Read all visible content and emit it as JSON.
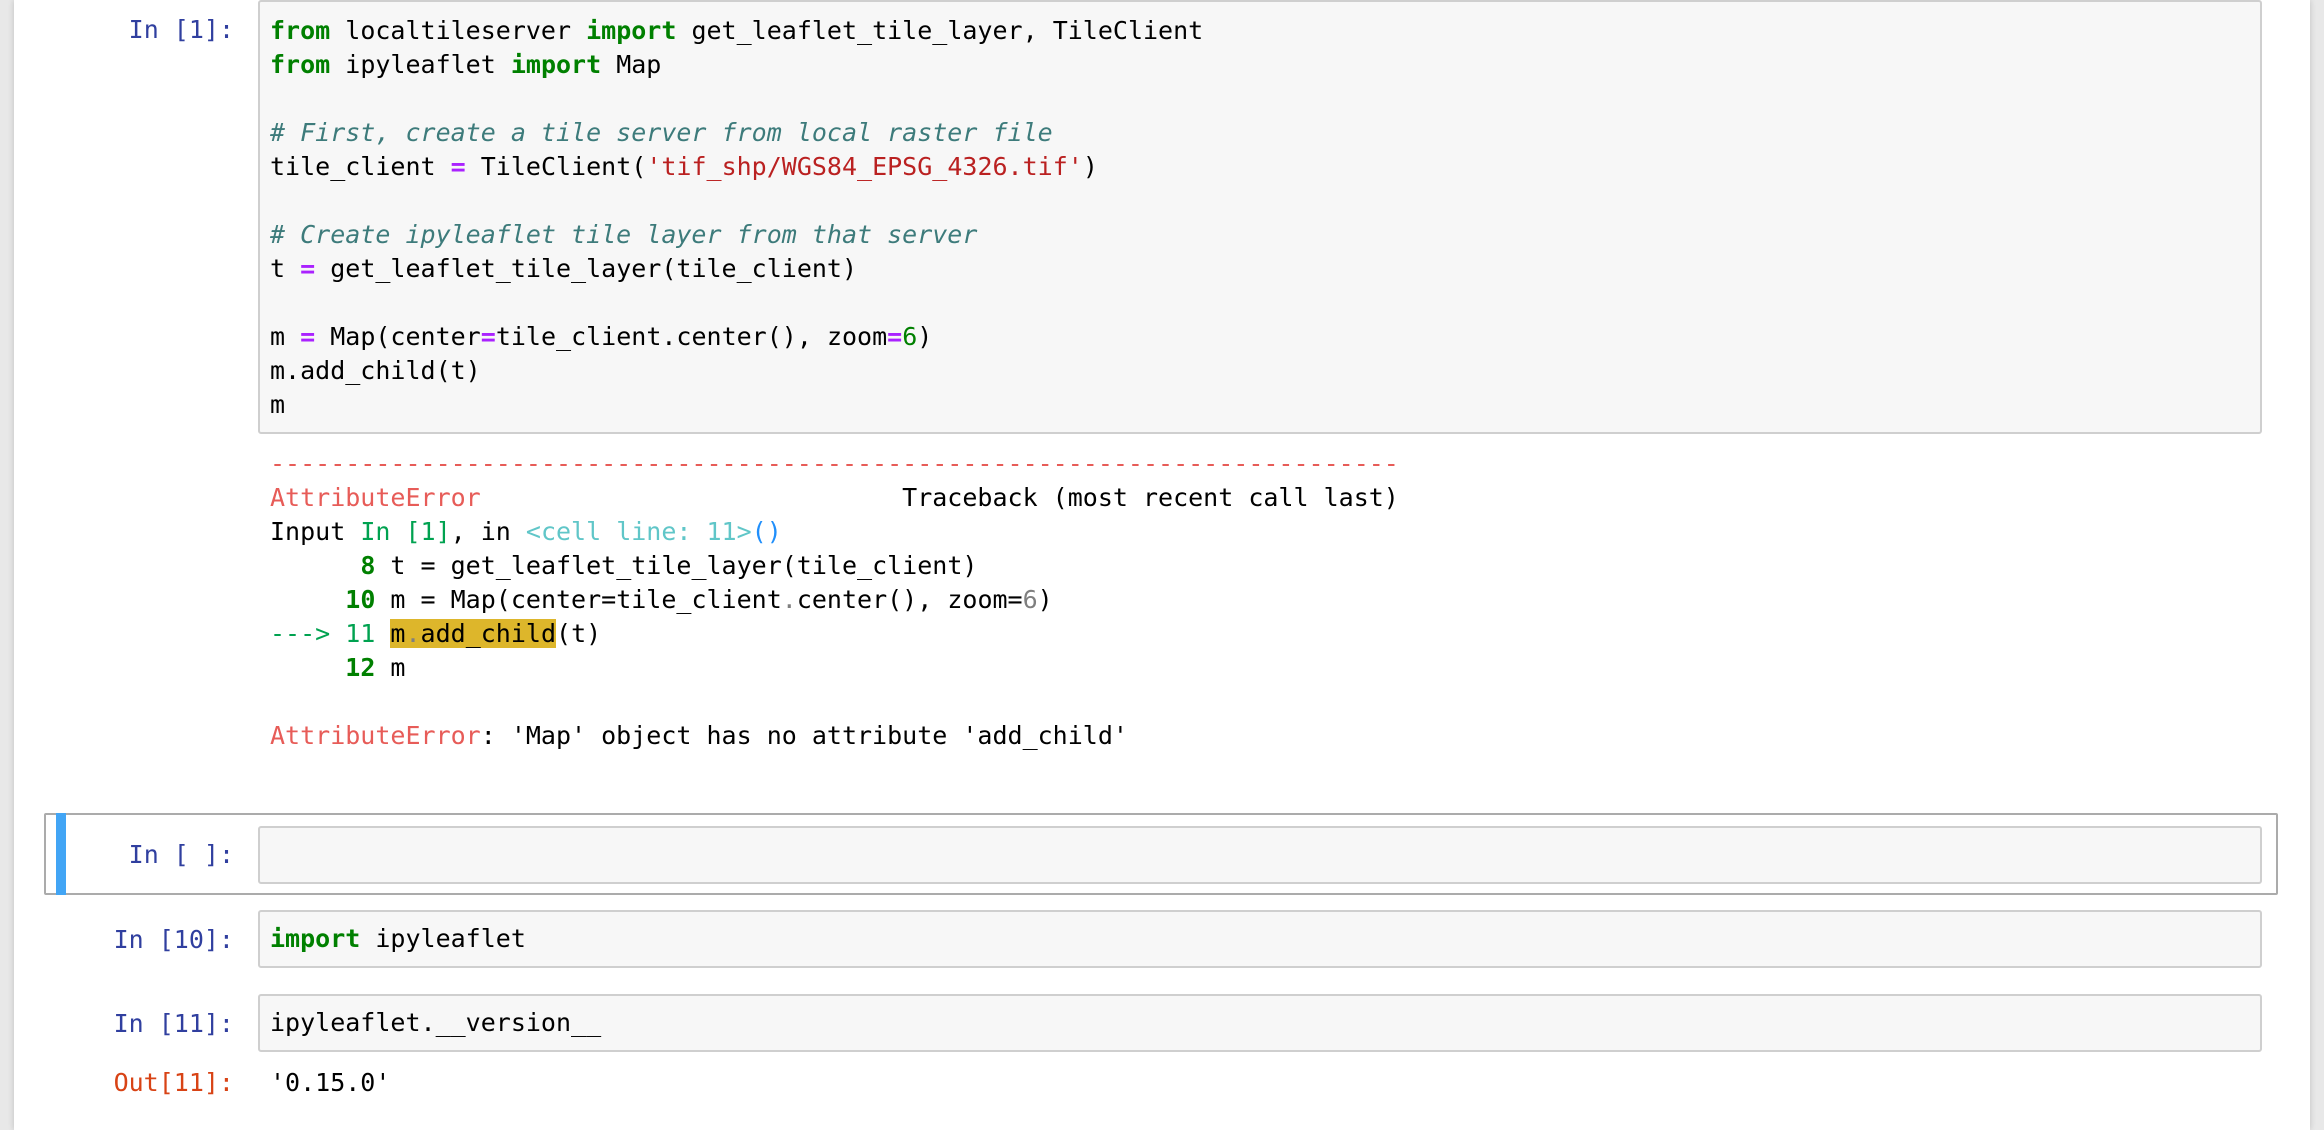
{
  "cells": [
    {
      "prompt": "In [1]:",
      "code": [
        [
          {
            "t": "from",
            "c": "kw"
          },
          {
            "t": " localtileserver "
          },
          {
            "t": "import",
            "c": "kw"
          },
          {
            "t": " get_leaflet_tile_layer, TileClient"
          }
        ],
        [
          {
            "t": "from",
            "c": "kw"
          },
          {
            "t": " ipyleaflet "
          },
          {
            "t": "import",
            "c": "kw"
          },
          {
            "t": " Map"
          }
        ],
        [],
        [
          {
            "t": "# First, create a tile server from local raster file",
            "c": "cm"
          }
        ],
        [
          {
            "t": "tile_client "
          },
          {
            "t": "=",
            "c": "op"
          },
          {
            "t": " TileClient("
          },
          {
            "t": "'tif_shp/WGS84_EPSG_4326.tif'",
            "c": "st"
          },
          {
            "t": ")"
          }
        ],
        [],
        [
          {
            "t": "# Create ipyleaflet tile layer from that server",
            "c": "cm"
          }
        ],
        [
          {
            "t": "t "
          },
          {
            "t": "=",
            "c": "op"
          },
          {
            "t": " get_leaflet_tile_layer(tile_client)"
          }
        ],
        [],
        [
          {
            "t": "m "
          },
          {
            "t": "=",
            "c": "op"
          },
          {
            "t": " Map(center"
          },
          {
            "t": "=",
            "c": "op"
          },
          {
            "t": "tile_client.center(), zoom"
          },
          {
            "t": "=",
            "c": "op"
          },
          {
            "t": "6",
            "c": "nu"
          },
          {
            "t": ")"
          }
        ],
        [
          {
            "t": "m.add_child(t)"
          }
        ],
        [
          {
            "t": "m"
          }
        ]
      ],
      "output": [
        [
          {
            "t": "---------------------------------------------------------------------------",
            "c": "tb-red"
          }
        ],
        [
          {
            "t": "AttributeError",
            "c": "tb-red"
          },
          {
            "t": "                            Traceback (most recent call last)"
          }
        ],
        [
          {
            "t": "Input "
          },
          {
            "t": "In [1]",
            "c": "tb-green"
          },
          {
            "t": ", in "
          },
          {
            "t": "<cell line: 11>",
            "c": "tb-cyan"
          },
          {
            "t": "()",
            "c": "tb-blue"
          }
        ],
        [
          {
            "t": "      "
          },
          {
            "t": "8",
            "c": "tb-lno"
          },
          {
            "t": " t = get_leaflet_tile_layer(tile_client)"
          }
        ],
        [
          {
            "t": "     "
          },
          {
            "t": "10",
            "c": "tb-lno"
          },
          {
            "t": " m = Map(center=tile_client"
          },
          {
            "t": ".",
            "c": "tb-gray"
          },
          {
            "t": "center(), zoom="
          },
          {
            "t": "6",
            "c": "tb-gray"
          },
          {
            "t": ")"
          }
        ],
        [
          {
            "t": "---> 11 ",
            "c": "tb-green"
          },
          {
            "t": "m",
            "c": "hl"
          },
          {
            "t": ".",
            "c": "hl tb-gray"
          },
          {
            "t": "add_child",
            "c": "hl"
          },
          {
            "t": "(t)"
          }
        ],
        [
          {
            "t": "     "
          },
          {
            "t": "12",
            "c": "tb-lno"
          },
          {
            "t": " m"
          }
        ],
        [],
        [
          {
            "t": "AttributeError",
            "c": "tb-red"
          },
          {
            "t": ": 'Map' object has no attribute 'add_child'"
          }
        ]
      ]
    },
    {
      "prompt": "In [ ]:",
      "code": [
        []
      ],
      "selected": true
    },
    {
      "prompt": "In [10]:",
      "code": [
        [
          {
            "t": "import",
            "c": "kw"
          },
          {
            "t": " ipyleaflet"
          }
        ]
      ]
    },
    {
      "prompt": "In [11]:",
      "code": [
        [
          {
            "t": "ipyleaflet.__version__"
          }
        ]
      ],
      "out_prompt": "Out[11]:",
      "out_text": "'0.15.0'"
    }
  ],
  "colors": {
    "prompt_in": "#303f9f",
    "prompt_out": "#d84315",
    "selected_bar": "#42a5f5",
    "traceback_red": "#e75c58",
    "highlight": "#ddb62b"
  }
}
